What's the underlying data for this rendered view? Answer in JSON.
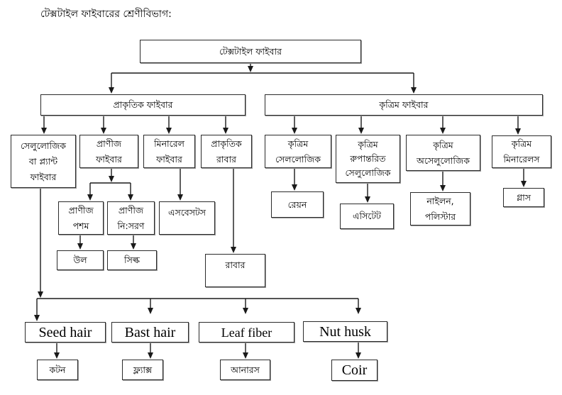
{
  "title": "টেক্সটাইল ফাইবারের শ্রেণীবিভাগ:",
  "nodes": {
    "root": "টেক্সটাইল ফাইবার",
    "natural": "প্রাকৃতিক ফাইবার",
    "synthetic": "কৃত্রিম ফাইবার",
    "cellulosic": "সেলুলোজিক\nবা প্ল্যান্ট\nফাইবার",
    "animal": "প্রাণীজ\nফাইবার",
    "mineral": "মিনারেল\nফাইবার",
    "natural_rubber": "প্রাকৃতিক\nরাবার",
    "animal_hair": "প্রাণীজ\nপশম",
    "animal_secretion": "প্রাণীজ\nনি:সরণ",
    "asbestos": "এসবেসটস",
    "wool": "উল",
    "silk": "সিল্ক",
    "rubber": "রাবার",
    "syn_cellulosic": "কৃত্রিম\nসেললোজিক",
    "syn_regenerated": "কৃত্রিম\nরুপান্তরিত\nসেলুলোজিক",
    "syn_noncellulosic": "কৃত্রিম\nঅসেলুলোজিক",
    "syn_mineral": "কৃত্রিম\nমিনারেলস",
    "rayon": "রেয়ন",
    "acetate": "এসিটেট",
    "nylon_polyester": "নাইলন,\nপলিস্টার",
    "glass": "গ্লাস",
    "seed_hair": "Seed hair",
    "bast_hair": "Bast hair",
    "leaf_fiber": "Leaf fiber",
    "nut_husk": "Nut husk",
    "cotton": "কটন",
    "flax": "ফ্ল্যাক্স",
    "pineapple": "আনারস",
    "coir": "Coir"
  }
}
